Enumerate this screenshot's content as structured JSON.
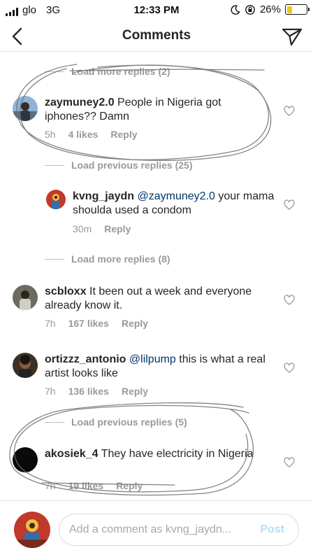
{
  "status_bar": {
    "carrier": "glo",
    "network": "3G",
    "time": "12:33 PM",
    "battery_percent": "26%",
    "battery_level": 0.26,
    "battery_color": "#f2c618"
  },
  "header": {
    "title": "Comments",
    "back_icon": "chevron-left-icon",
    "direct_icon": "paper-plane-icon"
  },
  "comments": [
    {
      "type": "load_link",
      "label": "Load more replies (2)"
    },
    {
      "type": "comment",
      "username": "zaymuney2.0",
      "text": " People in Nigeria got iphones?? Damn",
      "time": "5h",
      "likes": "4 likes",
      "reply": "Reply"
    },
    {
      "type": "load_link",
      "label": "Load previous replies (25)"
    },
    {
      "type": "reply",
      "username": "kvng_jaydn",
      "mention": "@zaymuney2.0",
      "text": " your mama shoulda used a condom",
      "time": "30m",
      "reply": "Reply"
    },
    {
      "type": "load_link",
      "label": "Load more replies (8)"
    },
    {
      "type": "comment",
      "username": "scbloxx",
      "text": " It been out a week and everyone already know it.",
      "time": "7h",
      "likes": "167 likes",
      "reply": "Reply"
    },
    {
      "type": "comment",
      "username": "ortizzz_antonio",
      "mention": "@lilpump",
      "text": "  this is what a real artist looks like",
      "time": "7h",
      "likes": "136 likes",
      "reply": "Reply"
    },
    {
      "type": "load_link",
      "label": "Load previous replies (5)"
    },
    {
      "type": "comment",
      "username": "akosiek_4",
      "text": " They have electricity in Nigeria",
      "time": "7h",
      "likes": "19 likes",
      "reply": "Reply"
    }
  ],
  "composer": {
    "placeholder": "Add a comment as kvng_jaydn...",
    "post_label": "Post"
  },
  "colors": {
    "mention": "#003569",
    "meta": "#999999",
    "post_disabled": "#b2dffc",
    "scribble": "#6e6e6e"
  }
}
